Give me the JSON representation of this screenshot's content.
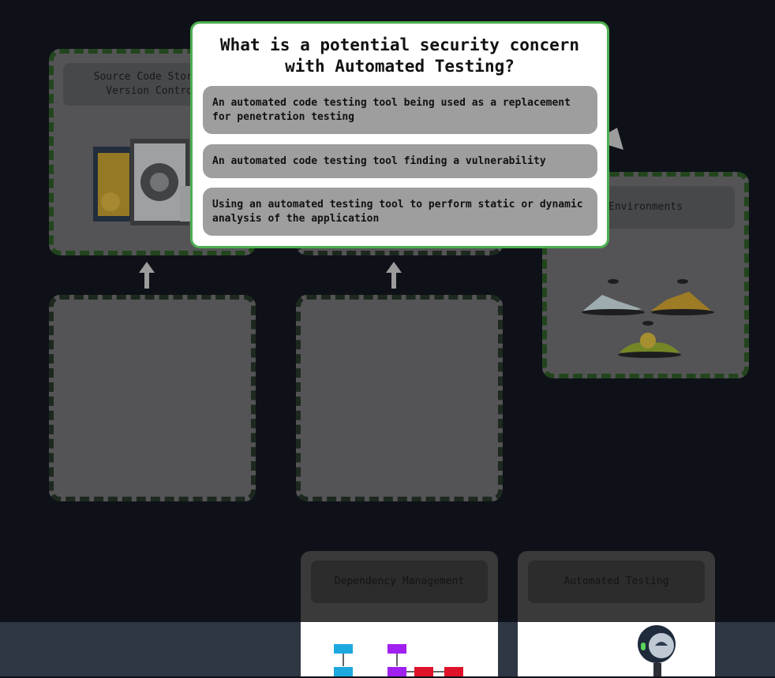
{
  "background_cards": {
    "source_code": "Source Code Storage\nVersion Control",
    "environments": "Environments"
  },
  "tools": {
    "dependency_management": "Dependency Management",
    "automated_testing": "Automated Testing"
  },
  "quiz": {
    "question": "What is a potential security concern with Automated Testing?",
    "options": [
      "An automated code testing tool being used as a replacement for penetration testing",
      "An automated code testing tool finding a vulnerability",
      "Using an automated testing tool to perform static or dynamic analysis of the application"
    ]
  },
  "colors": {
    "background": "#0e1118",
    "modal_border": "#4caf50",
    "option_bg": "#9e9e9e",
    "card_border": "#2b5a20"
  }
}
